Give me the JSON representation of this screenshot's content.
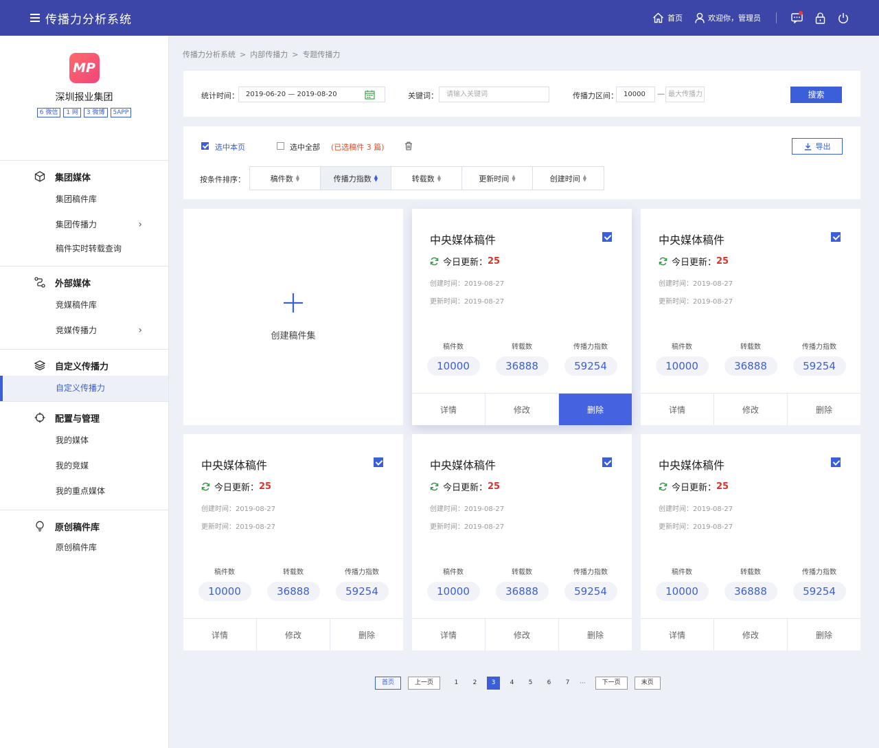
{
  "app": {
    "title": "传播力分析系统"
  },
  "topbar": {
    "home": "首页",
    "welcome": "欢迎你，管理员"
  },
  "sidebar": {
    "logo": "MP",
    "org": "深圳报业集团",
    "tags": [
      "6 微信",
      "1 网",
      "3 微博",
      "5APP"
    ],
    "groups": [
      {
        "title": "集团媒体",
        "items": [
          "集团稿件库",
          "集团传播力",
          "稿件实时转载查询"
        ]
      },
      {
        "title": "外部媒体",
        "items": [
          "竞媒稿件库",
          "竞媒传播力"
        ]
      },
      {
        "title": "自定义传播力",
        "items": [
          "自定义传播力"
        ]
      },
      {
        "title": "配置与管理",
        "items": [
          "我的媒体",
          "我的竞媒",
          "我的重点媒体"
        ]
      },
      {
        "title": "原创稿件库",
        "items": [
          "原创稿件库"
        ]
      }
    ]
  },
  "breadcrumb": [
    "传播力分析系统",
    "内部传播力",
    "专题传播力"
  ],
  "filter": {
    "time_label": "统计时间：",
    "time_value": "2019-06-20 — 2019-08-20",
    "keyword_label": "关键词：",
    "keyword_placeholder": "请输入关键词",
    "range_label": "传播力区间：",
    "range_min": "10000",
    "range_dash": "—",
    "range_max_placeholder": "最大传播力",
    "search": "搜索"
  },
  "actions": {
    "select_page": "选中本页",
    "select_all": "选中全部",
    "selected_info": "(已选稿件 3 篇)",
    "export": "导出",
    "sort_label": "按条件排序：",
    "sort_options": [
      "稿件数",
      "传播力指数",
      "转载数",
      "更新时间",
      "创建时间"
    ]
  },
  "create_card": {
    "label": "创建稿件集"
  },
  "cards": [
    {
      "title": "中央媒体稿件",
      "today_label": "今日更新：",
      "today_count": "25",
      "created": "创建时间：2019-08-27",
      "updated": "更新时间：2019-08-27",
      "stats": [
        {
          "label": "稿件数",
          "value": "10000"
        },
        {
          "label": "转载数",
          "value": "36888"
        },
        {
          "label": "传播力指数",
          "value": "59254"
        }
      ],
      "buttons": [
        "详情",
        "修改",
        "删除"
      ]
    },
    {
      "title": "中央媒体稿件",
      "today_label": "今日更新：",
      "today_count": "25",
      "created": "创建时间：2019-08-27",
      "updated": "更新时间：2019-08-27",
      "stats": [
        {
          "label": "稿件数",
          "value": "10000"
        },
        {
          "label": "转载数",
          "value": "36888"
        },
        {
          "label": "传播力指数",
          "value": "59254"
        }
      ],
      "buttons": [
        "详情",
        "修改",
        "删除"
      ]
    },
    {
      "title": "中央媒体稿件",
      "today_label": "今日更新：",
      "today_count": "25",
      "created": "创建时间：2019-08-27",
      "updated": "更新时间：2019-08-27",
      "stats": [
        {
          "label": "稿件数",
          "value": "10000"
        },
        {
          "label": "转载数",
          "value": "36888"
        },
        {
          "label": "传播力指数",
          "value": "59254"
        }
      ],
      "buttons": [
        "详情",
        "修改",
        "删除"
      ]
    },
    {
      "title": "中央媒体稿件",
      "today_label": "今日更新：",
      "today_count": "25",
      "created": "创建时间：2019-08-27",
      "updated": "更新时间：2019-08-27",
      "stats": [
        {
          "label": "稿件数",
          "value": "10000"
        },
        {
          "label": "转载数",
          "value": "36888"
        },
        {
          "label": "传播力指数",
          "value": "59254"
        }
      ],
      "buttons": [
        "详情",
        "修改",
        "删除"
      ]
    },
    {
      "title": "中央媒体稿件",
      "today_label": "今日更新：",
      "today_count": "25",
      "created": "创建时间：2019-08-27",
      "updated": "更新时间：2019-08-27",
      "stats": [
        {
          "label": "稿件数",
          "value": "10000"
        },
        {
          "label": "转载数",
          "value": "36888"
        },
        {
          "label": "传播力指数",
          "value": "59254"
        }
      ],
      "buttons": [
        "详情",
        "修改",
        "删除"
      ]
    }
  ],
  "pagination": {
    "first": "首页",
    "prev": "上一页",
    "pages": [
      "1",
      "2",
      "3",
      "4",
      "5",
      "6",
      "7"
    ],
    "ellipsis": "···",
    "next": "下一页",
    "last": "末页",
    "current": "3"
  },
  "colors": {
    "primary": "#3b5fd9",
    "header": "#3b46a8",
    "danger": "#d9342b"
  }
}
